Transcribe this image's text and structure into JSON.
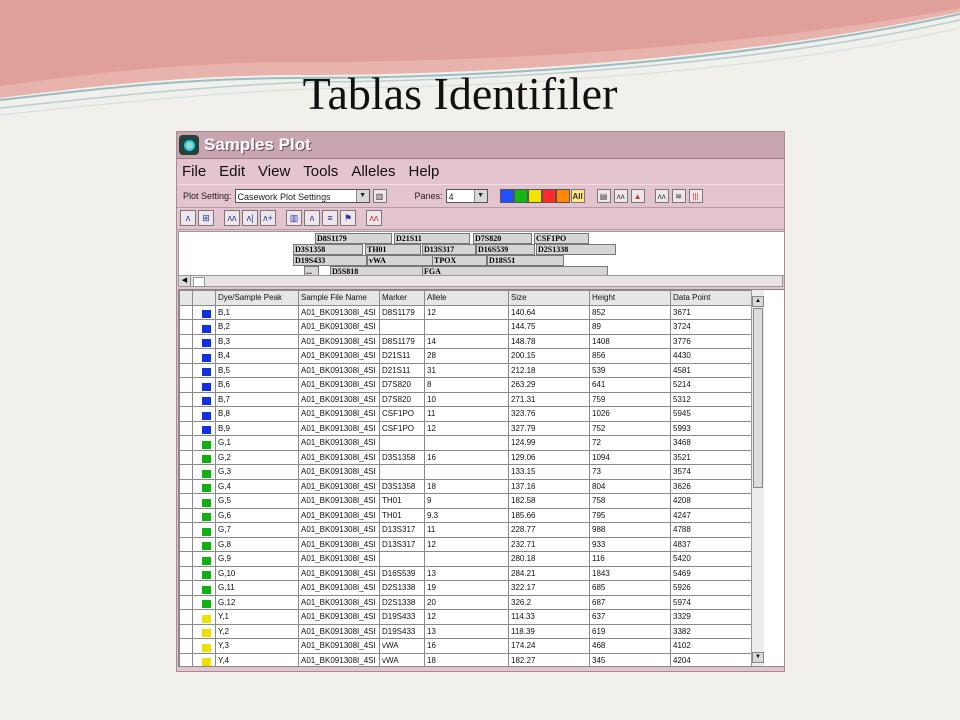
{
  "slide": {
    "title": "Tablas Identifiler"
  },
  "window": {
    "title": "Samples Plot"
  },
  "menu": [
    "File",
    "Edit",
    "View",
    "Tools",
    "Alleles",
    "Help"
  ],
  "toolbar": {
    "plot_setting_label": "Plot Setting:",
    "plot_setting_value": "Casework Plot Settings",
    "panes_label": "Panes:",
    "panes_value": "4",
    "all_label": "All",
    "dye_colors": [
      "#1f4fff",
      "#14b814",
      "#f2e400",
      "#ff2a2a",
      "#ff8a00"
    ]
  },
  "markers": [
    "D8S1179",
    "D21S11",
    "D7S820",
    "CSF1PO",
    "D3S1358",
    "TH01",
    "D13S317",
    "D16S539",
    "D2S1338",
    "D19S433",
    "vWA",
    "TPOX",
    "D18S51",
    "...",
    "D5S818",
    "FGA"
  ],
  "table": {
    "headers": [
      "Dye/Sample Peak",
      "Sample File Name",
      "Marker",
      "Allele",
      "Size",
      "Height",
      "Data Point"
    ],
    "dye_colors": {
      "B": "#1130e0",
      "G": "#10b010",
      "Y": "#f0e000"
    },
    "rows": [
      {
        "dye": "B",
        "peak": "B,1",
        "file": "A01_BK091308I_4SI",
        "marker": "D8S1179",
        "allele": "12",
        "size": "140.64",
        "height": "852",
        "point": "3671"
      },
      {
        "dye": "B",
        "peak": "B,2",
        "file": "A01_BK091308I_4SI",
        "marker": "",
        "allele": "",
        "size": "144.75",
        "height": "89",
        "point": "3724"
      },
      {
        "dye": "B",
        "peak": "B,3",
        "file": "A01_BK091308I_4SI",
        "marker": "D8S1179",
        "allele": "14",
        "size": "148.78",
        "height": "1408",
        "point": "3776"
      },
      {
        "dye": "B",
        "peak": "B,4",
        "file": "A01_BK091308I_4SI",
        "marker": "D21S11",
        "allele": "28",
        "size": "200.15",
        "height": "856",
        "point": "4430"
      },
      {
        "dye": "B",
        "peak": "B,5",
        "file": "A01_BK091308I_4SI",
        "marker": "D21S11",
        "allele": "31",
        "size": "212.18",
        "height": "539",
        "point": "4581"
      },
      {
        "dye": "B",
        "peak": "B,6",
        "file": "A01_BK091308I_4SI",
        "marker": "D7S820",
        "allele": "8",
        "size": "263.29",
        "height": "641",
        "point": "5214"
      },
      {
        "dye": "B",
        "peak": "B,7",
        "file": "A01_BK091308I_4SI",
        "marker": "D7S820",
        "allele": "10",
        "size": "271.31",
        "height": "759",
        "point": "5312"
      },
      {
        "dye": "B",
        "peak": "B,8",
        "file": "A01_BK091308I_4SI",
        "marker": "CSF1PO",
        "allele": "11",
        "size": "323.76",
        "height": "1026",
        "point": "5945"
      },
      {
        "dye": "B",
        "peak": "B,9",
        "file": "A01_BK091308I_4SI",
        "marker": "CSF1PO",
        "allele": "12",
        "size": "327.79",
        "height": "752",
        "point": "5993"
      },
      {
        "dye": "G",
        "peak": "G,1",
        "file": "A01_BK091308I_4SI",
        "marker": "",
        "allele": "",
        "size": "124.99",
        "height": "72",
        "point": "3468"
      },
      {
        "dye": "G",
        "peak": "G,2",
        "file": "A01_BK091308I_4SI",
        "marker": "D3S1358",
        "allele": "16",
        "size": "129.06",
        "height": "1094",
        "point": "3521"
      },
      {
        "dye": "G",
        "peak": "G,3",
        "file": "A01_BK091308I_4SI",
        "marker": "",
        "allele": "",
        "size": "133.15",
        "height": "73",
        "point": "3574"
      },
      {
        "dye": "G",
        "peak": "G,4",
        "file": "A01_BK091308I_4SI",
        "marker": "D3S1358",
        "allele": "18",
        "size": "137.16",
        "height": "804",
        "point": "3626"
      },
      {
        "dye": "G",
        "peak": "G,5",
        "file": "A01_BK091308I_4SI",
        "marker": "TH01",
        "allele": "9",
        "size": "182.58",
        "height": "758",
        "point": "4208"
      },
      {
        "dye": "G",
        "peak": "G,6",
        "file": "A01_BK091308I_4SI",
        "marker": "TH01",
        "allele": "9.3",
        "size": "185.66",
        "height": "795",
        "point": "4247"
      },
      {
        "dye": "G",
        "peak": "G,7",
        "file": "A01_BK091308I_4SI",
        "marker": "D13S317",
        "allele": "11",
        "size": "228.77",
        "height": "988",
        "point": "4788"
      },
      {
        "dye": "G",
        "peak": "G,8",
        "file": "A01_BK091308I_4SI",
        "marker": "D13S317",
        "allele": "12",
        "size": "232.71",
        "height": "933",
        "point": "4837"
      },
      {
        "dye": "G",
        "peak": "G,9",
        "file": "A01_BK091308I_4SI",
        "marker": "",
        "allele": "",
        "size": "280.18",
        "height": "116",
        "point": "5420"
      },
      {
        "dye": "G",
        "peak": "G,10",
        "file": "A01_BK091308I_4SI",
        "marker": "D16S539",
        "allele": "13",
        "size": "284.21",
        "height": "1843",
        "point": "5469"
      },
      {
        "dye": "G",
        "peak": "G,11",
        "file": "A01_BK091308I_4SI",
        "marker": "D2S1338",
        "allele": "19",
        "size": "322.17",
        "height": "685",
        "point": "5926"
      },
      {
        "dye": "G",
        "peak": "G,12",
        "file": "A01_BK091308I_4SI",
        "marker": "D2S1338",
        "allele": "20",
        "size": "326.2",
        "height": "687",
        "point": "5974"
      },
      {
        "dye": "Y",
        "peak": "Y,1",
        "file": "A01_BK091308I_4SI",
        "marker": "D19S433",
        "allele": "12",
        "size": "114.33",
        "height": "637",
        "point": "3329"
      },
      {
        "dye": "Y",
        "peak": "Y,2",
        "file": "A01_BK091308I_4SI",
        "marker": "D19S433",
        "allele": "13",
        "size": "118.39",
        "height": "619",
        "point": "3382"
      },
      {
        "dye": "Y",
        "peak": "Y,3",
        "file": "A01_BK091308I_4SI",
        "marker": "vWA",
        "allele": "16",
        "size": "174.24",
        "height": "468",
        "point": "4102"
      },
      {
        "dye": "Y",
        "peak": "Y,4",
        "file": "A01_BK091308I_4SI",
        "marker": "vWA",
        "allele": "18",
        "size": "182.27",
        "height": "345",
        "point": "4204"
      }
    ]
  }
}
